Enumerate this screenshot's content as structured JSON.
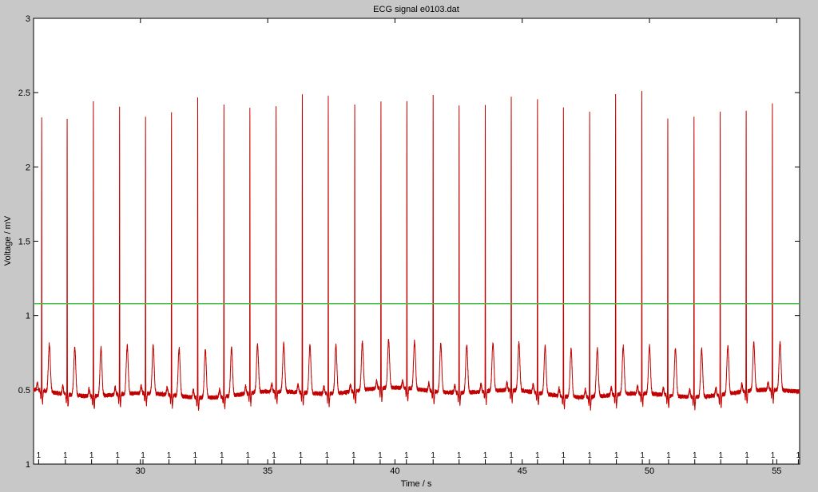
{
  "chart_data": {
    "type": "line",
    "title": "ECG signal e0103.dat",
    "xlabel": "Time / s",
    "ylabel": "Voltage / mV",
    "xlim": [
      25.8,
      55.9
    ],
    "ylim": [
      0,
      3
    ],
    "grid": false,
    "background_color": "#c8c8c8",
    "plot_background": "#ffffff",
    "x_tick_values": [
      30,
      35,
      40,
      45,
      50,
      55
    ],
    "x_tick_labels": [
      "30",
      "35",
      "40",
      "45",
      "50",
      "55"
    ],
    "y_tick_values": [
      0,
      0.5,
      1,
      1.5,
      2,
      2.5,
      3
    ],
    "y_tick_labels": [
      "1",
      "0.5",
      "1",
      "1.5",
      "2",
      "2.5",
      "3"
    ],
    "beat_markers": {
      "label": "1",
      "times": [
        26.0,
        27.05,
        28.08,
        29.1,
        30.1,
        31.12,
        32.15,
        33.2,
        34.22,
        35.25,
        36.3,
        37.33,
        38.38,
        39.42,
        40.45,
        41.5,
        42.52,
        43.55,
        44.57,
        45.6,
        46.62,
        47.65,
        48.7,
        49.72,
        50.75,
        51.78,
        52.8,
        53.83,
        54.85,
        55.85
      ]
    },
    "series": [
      {
        "color": "#c00000",
        "beats": [
          {
            "t": 26.12,
            "peak": 2.33
          },
          {
            "t": 27.12,
            "peak": 2.35
          },
          {
            "t": 28.15,
            "peak": 2.47
          },
          {
            "t": 29.18,
            "peak": 2.43
          },
          {
            "t": 30.2,
            "peak": 2.35
          },
          {
            "t": 31.22,
            "peak": 2.4
          },
          {
            "t": 32.25,
            "peak": 2.5
          },
          {
            "t": 33.28,
            "peak": 2.45
          },
          {
            "t": 34.3,
            "peak": 2.4
          },
          {
            "t": 35.33,
            "peak": 2.4
          },
          {
            "t": 36.36,
            "peak": 2.5
          },
          {
            "t": 37.38,
            "peak": 2.5
          },
          {
            "t": 38.42,
            "peak": 2.42
          },
          {
            "t": 39.45,
            "peak": 2.42
          },
          {
            "t": 40.47,
            "peak": 2.43
          },
          {
            "t": 41.5,
            "peak": 2.47
          },
          {
            "t": 42.52,
            "peak": 2.43
          },
          {
            "t": 43.55,
            "peak": 2.4
          },
          {
            "t": 44.57,
            "peak": 2.45
          },
          {
            "t": 45.6,
            "peak": 2.46
          },
          {
            "t": 46.62,
            "peak": 2.42
          },
          {
            "t": 47.65,
            "peak": 2.4
          },
          {
            "t": 48.67,
            "peak": 2.52
          },
          {
            "t": 49.7,
            "peak": 2.52
          },
          {
            "t": 50.72,
            "peak": 2.36
          },
          {
            "t": 51.75,
            "peak": 2.38
          },
          {
            "t": 52.78,
            "peak": 2.39
          },
          {
            "t": 53.8,
            "peak": 2.38
          },
          {
            "t": 54.83,
            "peak": 2.4
          }
        ],
        "baseline": 0.48,
        "t_wave_height": 0.8
      },
      {
        "color": "#44bb44",
        "constant_value": 1.08
      }
    ]
  }
}
